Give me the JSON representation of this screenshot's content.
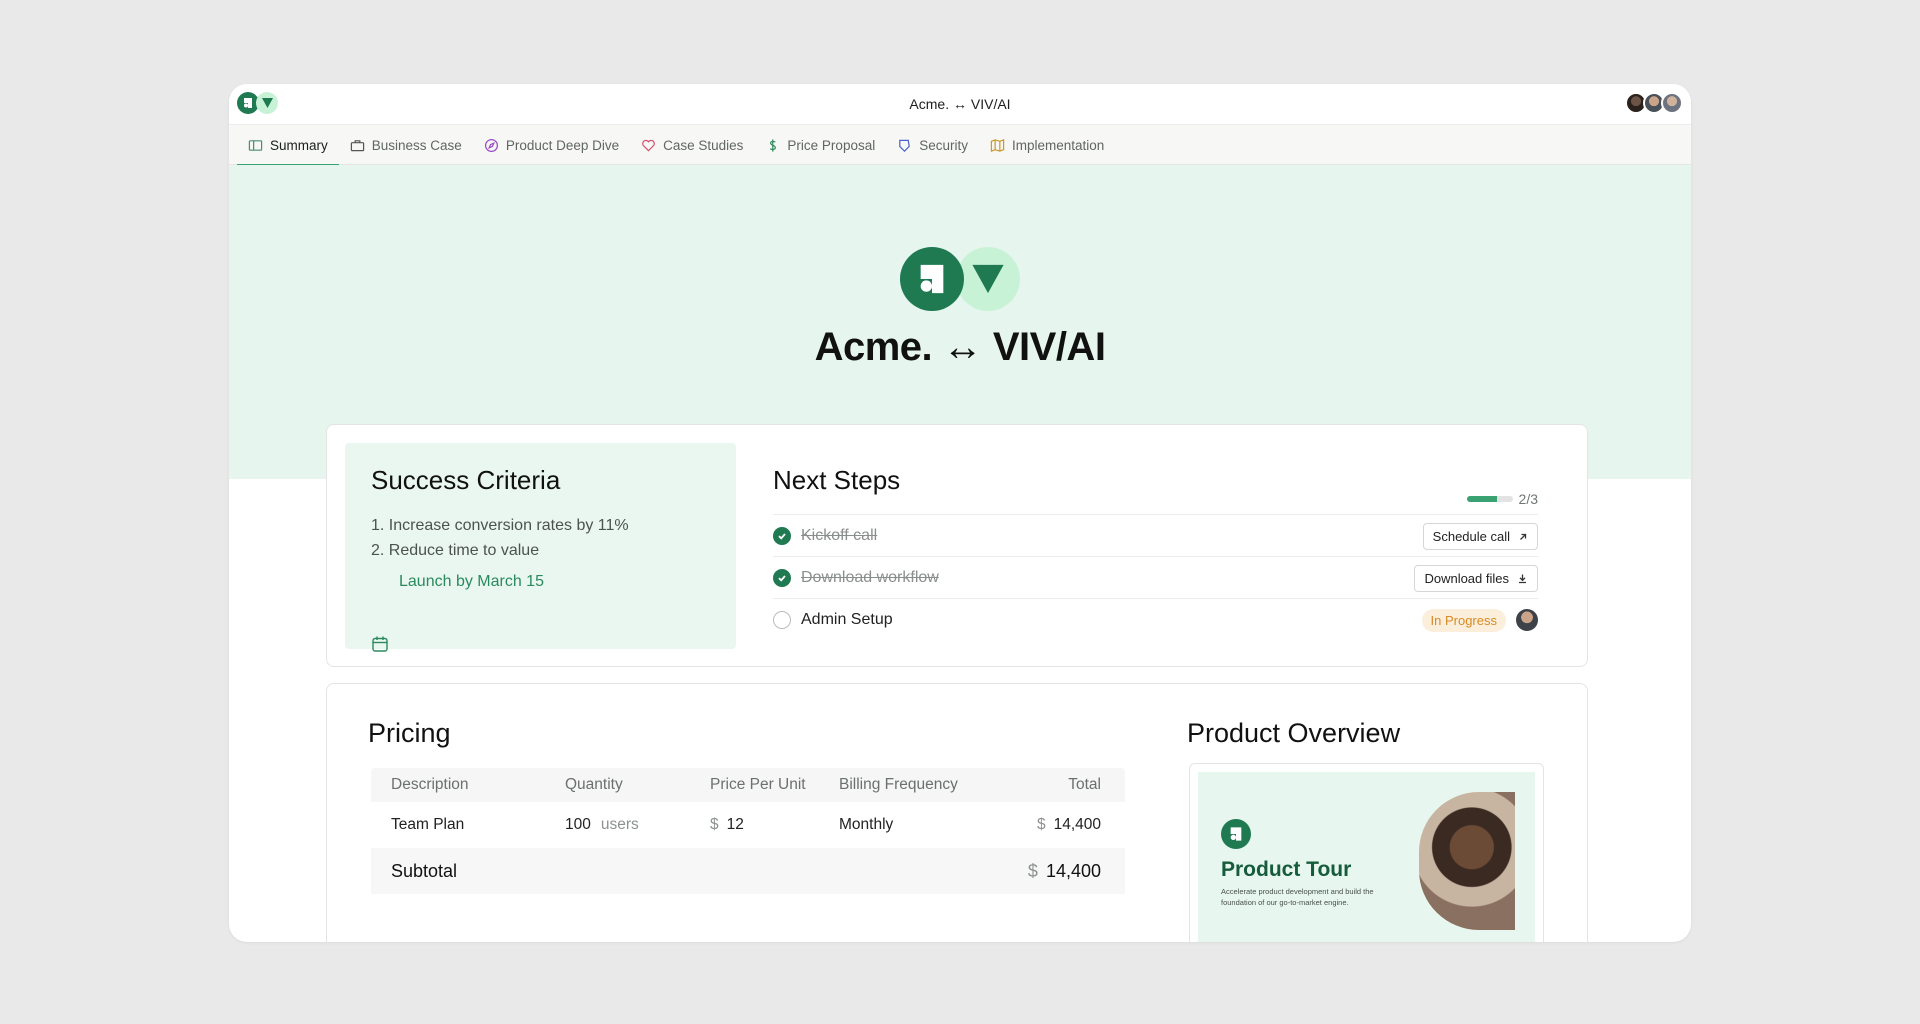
{
  "window": {
    "title": "Acme. ↔ VIV/AI"
  },
  "tabs": [
    {
      "label": "Summary",
      "icon": "book-icon",
      "active": true
    },
    {
      "label": "Business Case",
      "icon": "briefcase-icon"
    },
    {
      "label": "Product Deep Dive",
      "icon": "compass-icon"
    },
    {
      "label": "Case Studies",
      "icon": "heart-icon"
    },
    {
      "label": "Price Proposal",
      "icon": "dollar-icon"
    },
    {
      "label": "Security",
      "icon": "shield-icon"
    },
    {
      "label": "Implementation",
      "icon": "map-icon"
    }
  ],
  "hero": {
    "title": "Acme. ↔ VIV/AI"
  },
  "success_criteria": {
    "title": "Success Criteria",
    "items": [
      "1. Increase conversion rates by 11%",
      "2. Reduce time to value"
    ],
    "launch": "Launch by March 15"
  },
  "next_steps": {
    "title": "Next Steps",
    "progress_text": "2/3",
    "progress_fraction": 0.667,
    "steps": [
      {
        "label": "Kickoff call",
        "done": true,
        "action": "Schedule call",
        "action_icon": "arrow-up-right-icon"
      },
      {
        "label": "Download workflow",
        "done": true,
        "action": "Download files",
        "action_icon": "download-icon"
      },
      {
        "label": "Admin Setup",
        "done": false,
        "status": "In Progress"
      }
    ]
  },
  "pricing": {
    "title": "Pricing",
    "headers": [
      "Description",
      "Quantity",
      "Price Per Unit",
      "Billing Frequency",
      "Total"
    ],
    "rows": [
      {
        "description": "Team Plan",
        "quantity": "100",
        "unit": "users",
        "currency": "$",
        "price": "12",
        "frequency": "Monthly",
        "total": "14,400"
      }
    ],
    "subtotal_label": "Subtotal",
    "subtotal_currency": "$",
    "subtotal": "14,400"
  },
  "product_overview": {
    "title": "Product Overview",
    "card_title": "Product Tour",
    "card_desc": "Accelerate product development and build the foundation of our go-to-market engine."
  },
  "colors": {
    "accent": "#1f7a52",
    "accent_light": "#c8f2d6",
    "hero_bg": "#e6f6ee",
    "badge_bg": "#fbeedb",
    "badge_text": "#d98a24"
  }
}
